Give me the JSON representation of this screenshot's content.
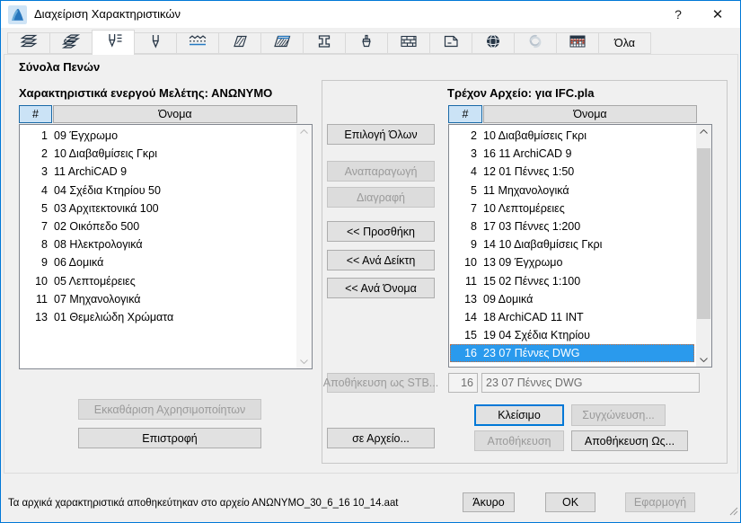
{
  "window": {
    "title": "Διαχείριση Χαρακτηριστικών",
    "help_label": "?",
    "close_label": "✕"
  },
  "tabs": {
    "all_label": "Όλα",
    "selected_icon": "pen-sets-icon",
    "icons": [
      "layers-icon",
      "layer-combinations-icon",
      "pen-sets-icon",
      "pens-icon",
      "line-types-icon",
      "fill-types-icon",
      "composites-icon",
      "profiles-icon",
      "surfaces-icon",
      "building-materials-icon",
      "zone-categories-icon",
      "cities-icon",
      "operation-profiles-icon",
      "mep-systems-icon"
    ]
  },
  "pen_sets_label": "Σύνολα Πενών",
  "left_panel": {
    "title": "Χαρακτηριστικά ενεργού Μελέτης: ΑΝΩΝΥΜΟ",
    "col_index": "#",
    "col_name": "Όνομα",
    "rows": [
      {
        "num": "1",
        "name": "09 Έγχρωμο"
      },
      {
        "num": "2",
        "name": "10 Διαβαθμίσεις Γκρι"
      },
      {
        "num": "3",
        "name": "11 ArchiCAD 9"
      },
      {
        "num": "4",
        "name": "04 Σχέδια Κτηρίου 50"
      },
      {
        "num": "5",
        "name": "03 Αρχιτεκτονικά 100"
      },
      {
        "num": "7",
        "name": "02 Οικόπεδο 500"
      },
      {
        "num": "8",
        "name": "08 Ηλεκτρολογικά"
      },
      {
        "num": "9",
        "name": "06 Δομικά"
      },
      {
        "num": "10",
        "name": "05 Λεπτομέρειες"
      },
      {
        "num": "11",
        "name": "07 Μηχανολογικά"
      },
      {
        "num": "13",
        "name": "01 Θεμελιώδη Χρώματα"
      }
    ],
    "purge_button": "Εκκαθάριση Αχρησιμοποίητων",
    "revert_button": "Επιστροφή"
  },
  "middle": {
    "select_all": "Επιλογή Όλων",
    "duplicate": "Αναπαραγωγή",
    "delete": "Διαγραφή",
    "append": "<< Προσθήκη",
    "by_index": "<< Ανά Δείκτη",
    "by_name": "<< Ανά Όνομα",
    "save_as_stb": "Αποθήκευση ως STB...",
    "to_file": "σε Αρχείο..."
  },
  "right_panel": {
    "title": "Τρέχον Αρχείο: για IFC.pla",
    "col_index": "#",
    "col_name": "Όνομα",
    "rows": [
      {
        "num": "2",
        "name": "10 Διαβαθμίσεις Γκρι"
      },
      {
        "num": "3",
        "name": "16 11 ArchiCAD 9"
      },
      {
        "num": "4",
        "name": "12 01 Πέννες 1:50"
      },
      {
        "num": "5",
        "name": "11 Μηχανολογικά"
      },
      {
        "num": "7",
        "name": "10 Λεπτομέρειες"
      },
      {
        "num": "8",
        "name": "17 03 Πέννες 1:200"
      },
      {
        "num": "9",
        "name": "14 10 Διαβαθμίσεις Γκρι"
      },
      {
        "num": "10",
        "name": "13 09 Έγχρωμο"
      },
      {
        "num": "11",
        "name": "15 02 Πέννες 1:100"
      },
      {
        "num": "13",
        "name": "09 Δομικά"
      },
      {
        "num": "14",
        "name": "18 ArchiCAD 11 INT"
      },
      {
        "num": "15",
        "name": "19 04 Σχέδια Κτηρίου"
      },
      {
        "num": "16",
        "name": "23 07 Πέννες DWG",
        "selected": true
      }
    ],
    "index_field_value": "16",
    "name_field_value": "23 07 Πέννες DWG",
    "close_button": "Κλείσιμο",
    "merge_button": "Συγχώνευση...",
    "save_button": "Αποθήκευση",
    "save_as_button": "Αποθήκευση Ως..."
  },
  "footer": {
    "status": "Τα αρχικά χαρακτηριστικά αποθηκεύτηκαν στο αρχείο ΑΝΩΝΥΜΟ_30_6_16 10_14.aat",
    "cancel": "Άκυρο",
    "ok": "OK",
    "apply": "Εφαρμογή"
  },
  "colors": {
    "window_border": "#0078d7",
    "selection_blue": "#2a9aed",
    "icon_blue": "#2579c2",
    "icon_red": "#cf3a1e",
    "header_active_bg": "#cbe3f6"
  }
}
